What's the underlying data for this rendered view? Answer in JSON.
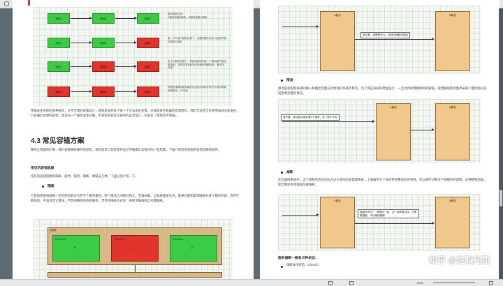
{
  "viewer": {
    "page_indicator": "100%",
    "status_left": "",
    "watermark": "知乎 @佐取凡翔"
  },
  "left_page": {
    "diagram_rows": [
      {
        "a": "服务A",
        "b": "服务B",
        "c": "服务C",
        "colors": [
          "green",
          "green",
          "green"
        ],
        "note": "服务调用关系：\n A服务依赖B服务，B服务依赖C服务"
      },
      {
        "a": "服务A",
        "b": "服务B",
        "c": "服务C",
        "colors": [
          "green",
          "green",
          "red"
        ],
        "note": "某一个时刻C服务挂掉了，但是B服务的访问还是不断的请求C服务"
      },
      {
        "a": "服务A",
        "b": "服务B",
        "c": "服务C",
        "colors": [
          "green",
          "red",
          "red"
        ],
        "note": "由于C服务挂掉了，导致B服务的每一个请求都不能正常返回，进而导致B服务的线程资源被耗尽，服务不可用"
      },
      {
        "a": "服务A",
        "b": "服务B",
        "c": "服务C",
        "colors": [
          "red",
          "red",
          "red"
        ],
        "note": "同样的道理A服务最终也会因为B服务的不可用而导致资源耗尽，不可用"
      }
    ],
    "para1": "雪崩发生的原因多种多样，有不合理的容量设计，或者是高并发下某一个方法响应变慢，亦或是某台机器的资源耗尽。我们无法完全杜绝雪崩源头的发生，只有做好足够的容错，保证在一个服务发生问题，不会影响到其它服务的正常运行。也就是「雪落而不雪崩」。",
    "section_title": "4.3 常见容错方案",
    "para2": "要防止雪崩的扩散，我们就要做好服务的容错，容错说白了就是保护自己不被猪队友拖垮的一些措施，下面介绍常见的服务容错思路和组件。",
    "subtitle": "常见的容错思路",
    "para3": "常见的容错思路有隔离、超时、限流、熔断、降级这几种，下面分别介绍一下。",
    "bullet1": "隔离",
    "para4": "它是指将系统按照一定的原则划分为若干个服务模块，各个模块之间相对独立，无强依赖。当有故障发生时，能将问题和影响隔离在某个模块内部，而不扩散风险，不波及其它模块，不影响整体的系统服务。常见的隔离方式有：线程池隔离和信号量隔离。",
    "iso": {
      "title": "A服务",
      "threads": [
        {
          "label": "Thread-c",
          "sub": "B",
          "color": "green"
        },
        {
          "label": "Thread-b",
          "sub": "C",
          "color": "red"
        },
        {
          "label": "Thread-a",
          "sub": "D",
          "color": "green"
        }
      ]
    }
  },
  "right_page": {
    "d1": {
      "a": "A服务",
      "b": "B服务",
      "label": "快点哦，我要等待1s，没回应就取消连接"
    },
    "bullet_limit": "限流",
    "para_limit": "限流就是限制系统的输入和输出流量已达到保护系统的目的。为了保证系统的稳固运行，一旦达到的需要限制的阈值，就需要限制流量并采取少量措施以完成限制流量的目的。",
    "d2": {
      "a": "A服务",
      "b": "B服务",
      "label": "我不管，我这里1s就处理3个请求，多了我不干啦"
    },
    "bullet_break": "熔断",
    "para_break": "在互联网系统中，当下游服务因访问压力过大而响应变慢或失败，上游服务为了保护系统整体的可用性，可以暂时切断对下游服务的调用。这种牺牲局部，保全整体的措施就叫做熔断。",
    "d3": {
      "a": "A服务",
      "b": "B服务",
      "label": "就暂停对B了，就挺好一会，过一会再再试试，行是再熔断，不行继续熔断"
    },
    "sub_states": "服务熔断一般有三种状态：",
    "state1": "熔断关闭状态（Closed）"
  }
}
